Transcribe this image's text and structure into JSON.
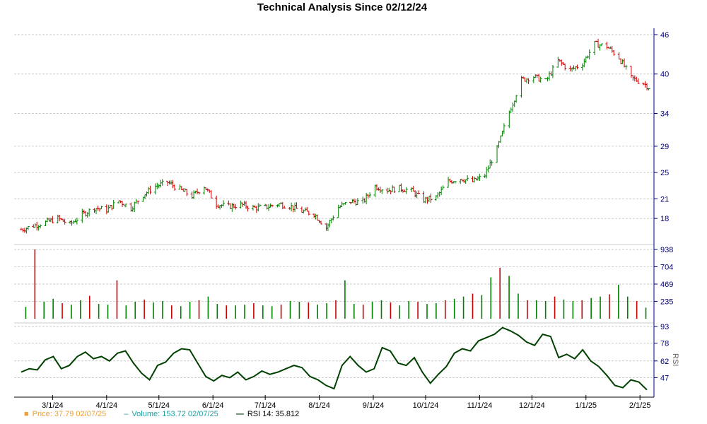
{
  "title": "Technical Analysis Since 02/12/24",
  "colors": {
    "up": "#008000",
    "down": "#cc0000",
    "price_legend": "#f0a030",
    "volume_legend": "#20a0a0",
    "rsi_line": "#004000",
    "grid": "#bbbbbb",
    "axis": "#000080"
  },
  "legend": {
    "price": "Price: 37.79  02/07/25",
    "volume": "Volume: 153.72  02/07/25",
    "rsi": "RSI 14: 35.812"
  },
  "chart_data": [
    {
      "type": "line",
      "name": "price",
      "ylim": [
        15,
        46
      ],
      "y_ticks": [
        18,
        21,
        25,
        29,
        34,
        40,
        46
      ],
      "x_tick_labels": [
        "3/1/24",
        "4/1/24",
        "5/1/24",
        "6/1/24",
        "7/1/24",
        "8/1/24",
        "9/1/24",
        "10/1/24",
        "11/1/24",
        "12/1/24",
        "1/1/25",
        "2/1/25"
      ],
      "x_tick_dates": [
        "2024-03-01",
        "2024-04-01",
        "2024-05-01",
        "2024-06-01",
        "2024-07-01",
        "2024-08-01",
        "2024-09-01",
        "2024-10-01",
        "2024-11-01",
        "2024-12-01",
        "2025-01-01",
        "2025-02-01"
      ],
      "x_range": [
        "2024-02-12",
        "2025-02-07"
      ],
      "closes": [
        [
          "2024-02-12",
          16.3
        ],
        [
          "2024-02-19",
          16.9
        ],
        [
          "2024-02-26",
          17.4
        ],
        [
          "2024-03-04",
          18.0
        ],
        [
          "2024-03-11",
          17.1
        ],
        [
          "2024-03-18",
          18.6
        ],
        [
          "2024-03-25",
          19.6
        ],
        [
          "2024-04-01",
          19.3
        ],
        [
          "2024-04-08",
          20.7
        ],
        [
          "2024-04-15",
          19.6
        ],
        [
          "2024-04-22",
          21.6
        ],
        [
          "2024-04-29",
          22.9
        ],
        [
          "2024-05-06",
          23.5
        ],
        [
          "2024-05-13",
          22.4
        ],
        [
          "2024-05-20",
          21.4
        ],
        [
          "2024-05-27",
          22.9
        ],
        [
          "2024-06-03",
          20.2
        ],
        [
          "2024-06-10",
          19.8
        ],
        [
          "2024-06-17",
          20.1
        ],
        [
          "2024-06-24",
          19.6
        ],
        [
          "2024-07-01",
          19.7
        ],
        [
          "2024-07-08",
          20.2
        ],
        [
          "2024-07-15",
          19.9
        ],
        [
          "2024-07-22",
          19.1
        ],
        [
          "2024-07-29",
          18.7
        ],
        [
          "2024-08-05",
          16.6
        ],
        [
          "2024-08-12",
          19.7
        ],
        [
          "2024-08-19",
          20.6
        ],
        [
          "2024-08-26",
          20.5
        ],
        [
          "2024-09-02",
          22.9
        ],
        [
          "2024-09-09",
          22.3
        ],
        [
          "2024-09-16",
          22.6
        ],
        [
          "2024-09-23",
          22.2
        ],
        [
          "2024-09-30",
          20.8
        ],
        [
          "2024-10-07",
          21.2
        ],
        [
          "2024-10-14",
          23.6
        ],
        [
          "2024-10-21",
          24.1
        ],
        [
          "2024-10-28",
          23.6
        ],
        [
          "2024-11-04",
          24.6
        ],
        [
          "2024-11-11",
          28.6
        ],
        [
          "2024-11-18",
          34.2
        ],
        [
          "2024-11-25",
          39.1
        ],
        [
          "2024-12-02",
          39.6
        ],
        [
          "2024-12-09",
          38.9
        ],
        [
          "2024-12-16",
          42.0
        ],
        [
          "2024-12-23",
          40.6
        ],
        [
          "2024-12-30",
          41.6
        ],
        [
          "2025-01-06",
          44.6
        ],
        [
          "2025-01-13",
          44.2
        ],
        [
          "2025-01-20",
          42.5
        ],
        [
          "2025-01-27",
          39.4
        ],
        [
          "2025-02-03",
          38.6
        ],
        [
          "2025-02-07",
          37.8
        ]
      ]
    },
    {
      "type": "bar",
      "name": "volume",
      "ylim": [
        0,
        938
      ],
      "y_ticks": [
        235,
        469,
        704,
        938
      ],
      "values": [
        160,
        938,
        230,
        270,
        210,
        190,
        250,
        310,
        200,
        190,
        520,
        180,
        230,
        260,
        220,
        240,
        180,
        170,
        230,
        250,
        300,
        200,
        180,
        180,
        190,
        210,
        180,
        170,
        190,
        240,
        230,
        220,
        190,
        210,
        250,
        520,
        200,
        190,
        230,
        250,
        220,
        180,
        240,
        230,
        200,
        210,
        250,
        270,
        300,
        340,
        320,
        560,
        690,
        580,
        340,
        250,
        250,
        240,
        300,
        260,
        240,
        250,
        280,
        300,
        330,
        460,
        300,
        240,
        150
      ]
    },
    {
      "type": "line",
      "name": "rsi",
      "ylabel": "RSI",
      "ylim": [
        32,
        93
      ],
      "y_ticks": [
        47,
        62,
        78,
        93
      ],
      "values": [
        52,
        55,
        54,
        63,
        66,
        55,
        58,
        66,
        70,
        64,
        66,
        62,
        69,
        71,
        60,
        51,
        45,
        58,
        61,
        69,
        73,
        72,
        60,
        48,
        44,
        49,
        47,
        52,
        45,
        48,
        53,
        50,
        52,
        55,
        58,
        56,
        48,
        45,
        40,
        37,
        58,
        66,
        58,
        52,
        55,
        74,
        71,
        60,
        58,
        65,
        52,
        42,
        50,
        57,
        69,
        73,
        71,
        80,
        83,
        86,
        92,
        89,
        85,
        79,
        76,
        86,
        84,
        65,
        68,
        64,
        72,
        62,
        57,
        49,
        40,
        38,
        45,
        43,
        36
      ]
    }
  ]
}
